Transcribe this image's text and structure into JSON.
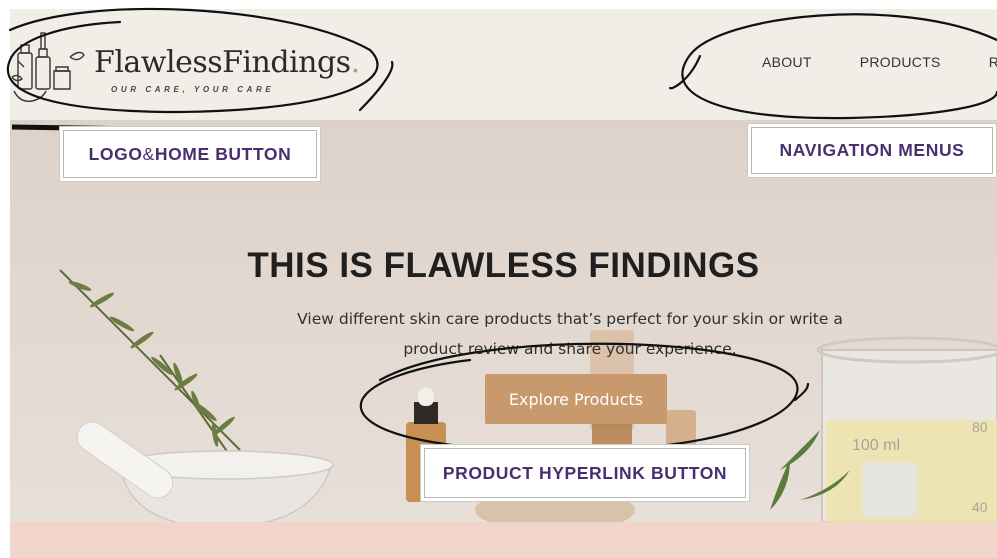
{
  "brand": {
    "name": "FlawlessFindings",
    "dot": ".",
    "tagline": "OUR CARE, YOUR CARE"
  },
  "nav": {
    "items": [
      {
        "label": "ABOUT"
      },
      {
        "label": "PRODUCTS"
      },
      {
        "label": "RE"
      }
    ]
  },
  "hero": {
    "title": "THIS IS FLAWLESS FINDINGS",
    "subtitle": "View different skin care products that’s perfect for your skin or write a product review and share your experience.",
    "cta_label": "Explore Products",
    "beaker_label": "100 ml",
    "beaker_mark": "80",
    "beaker_mark_low": "40"
  },
  "annotations": {
    "logo_prefix": "LOGO",
    "logo_amp": " & ",
    "logo_suffix": "HOME BUTTON",
    "nav": "NAVIGATION MENUS",
    "product": "PRODUCT HYPERLINK BUTTON"
  },
  "colors": {
    "header_bg": "#f1ede7",
    "cta_bg": "#c9996e",
    "annotation_text": "#4a2f6e",
    "footer_strip": "#f1d5cb"
  }
}
